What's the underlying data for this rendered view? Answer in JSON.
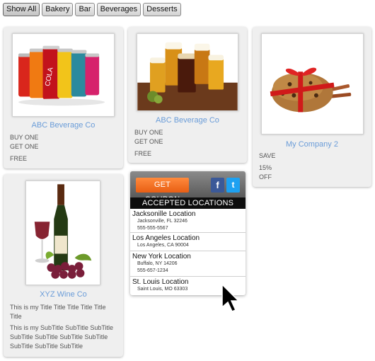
{
  "filters": [
    "Show All",
    "Bakery",
    "Bar",
    "Beverages",
    "Desserts"
  ],
  "cards": [
    {
      "brand": "ABC Beverage Co",
      "lines": [
        "BUY ONE",
        "GET ONE"
      ],
      "extra": "FREE"
    },
    {
      "brand": "ABC Beverage Co",
      "lines": [
        "BUY ONE",
        "GET ONE"
      ],
      "extra": "FREE"
    },
    {
      "brand": "My Company 2",
      "lines": [
        "SAVE"
      ],
      "extra_lines": [
        "15%",
        "OFF"
      ]
    },
    {
      "brand": "XYZ Wine Co",
      "title": "This is my Title Title Title Title Title Title",
      "subtitle": "This is my SubTitle SubTitle SubTitle SubTitle SubTitle SubTitle SubTitle SubTitle SubTitle SubTitle"
    }
  ],
  "coupon": {
    "button_label": "GET COUPON",
    "facebook_glyph": "f",
    "twitter_glyph": "t",
    "locations_title": "ACCEPTED LOCATIONS",
    "locations": [
      {
        "name": "Jacksonille Location",
        "address": "Jacksonville, FL 32246",
        "phone": "555-555-5567"
      },
      {
        "name": "Los Angeles Location",
        "address": "Los Angeles, CA 90004",
        "phone": ""
      },
      {
        "name": "New York Location",
        "address": "Buffalo, NY 14206",
        "phone": "555-657-1234"
      },
      {
        "name": "St. Louis Location",
        "address": "Saint Louis, MO 63303",
        "phone": ""
      }
    ]
  },
  "icons": {
    "card1": "soda-cans-image",
    "card2": "beer-mugs-image",
    "card3": "gift-cookies-image",
    "card4": "wine-bottle-grapes-image",
    "cursor": "mouse-pointer-icon"
  },
  "colors": {
    "brand_link": "#6a9cd8",
    "coupon_button": "#f06a1e",
    "facebook": "#3b5998",
    "twitter": "#1da1f2"
  }
}
